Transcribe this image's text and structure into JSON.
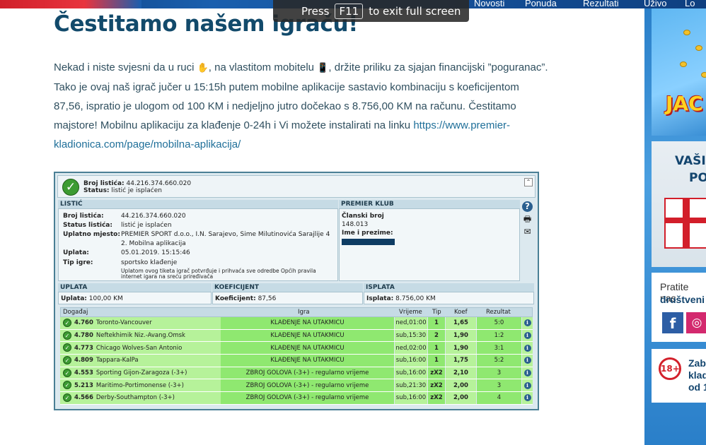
{
  "header": {
    "nav": [
      "Novosti",
      "Ponuda",
      "Rezultati",
      "Uživo",
      "Lo"
    ]
  },
  "fullscreen": {
    "press": "Press",
    "key": "F11",
    "suffix": "to exit full screen"
  },
  "article": {
    "title": "Čestitamo našem igraču!",
    "p1": "Nekad i niste svjesni da u ruci ",
    "icon_hand": "✋",
    "p2": ", na vlastitom mobitelu ",
    "icon_phone": "📱",
    "p3": ", držite priliku za sjajan financijski ”poguranac”. Tako je ovaj naš igrač jučer u 15:15h putem mobilne aplikacije sastavio kombinaciju s koeficijentom 87,56, ispratio je ulogom od 100 KM i nedjeljno jutro dočekao s 8.756,00 KM na računu. Čestitamo majstore! Mobilnu aplikaciju za klađenje 0-24h i Vi možete instalirati na linku ",
    "link": "https://www.premier-kladionica.com/page/mobilna-aplikacija/"
  },
  "ticket": {
    "head": {
      "l1_label": "Broj listića:",
      "l1_value": "44.216.374.660.020",
      "l2_label": "Status:",
      "l2_value": "listić je isplaćen"
    },
    "listic": {
      "title": "LISTIĆ",
      "rows": [
        {
          "label": "Broj listića:",
          "value": "44.216.374.660.020"
        },
        {
          "label": "Status listića:",
          "value": "listić je isplaćen"
        },
        {
          "label": "Uplatno mjesto:",
          "value": "PREMIER SPORT d.o.o., I.N. Sarajevo, Sime Milutinovića Sarajlije 4"
        },
        {
          "label": "",
          "value": "2. Mobilna aplikacija"
        },
        {
          "label": "Uplata:",
          "value": "05.01.2019. 15:15:46"
        },
        {
          "label": "Tip igre:",
          "value": "sportsko klađenje"
        }
      ],
      "note": "Uplatom ovog tiketa igrač potvrđuje i prihvaća sve odredbe Općih pravila internet igara na sreću priređivača"
    },
    "club": {
      "title": "PREMIER KLUB",
      "member_label": "Članski broj",
      "member_value": "148.013",
      "name_label": "Ime i prezime:"
    },
    "uplata": {
      "title": "UPLATA",
      "label": "Uplata:",
      "value": "100,00 KM"
    },
    "koef": {
      "title": "KOEFICIJENT",
      "label": "Koeficijent:",
      "value": "87,56"
    },
    "isplata": {
      "title": "ISPLATA",
      "label": "Isplata:",
      "value": "8.756,00 KM"
    },
    "columns": {
      "event": "Događaj",
      "game": "Igra",
      "time": "Vrijeme",
      "tip": "Tip",
      "odd": "Koef",
      "result": "Rezultat"
    },
    "rows": [
      {
        "code": "4.760",
        "event": "Toronto-Vancouver",
        "game": "KLAĐENJE NA UTAKMICU",
        "time": "ned,01:00",
        "tip": "1",
        "odd": "1,65",
        "result": "5:0"
      },
      {
        "code": "4.780",
        "event": "Neftekhimik Niz.-Avang.Omsk",
        "game": "KLAĐENJE NA UTAKMICU",
        "time": "sub,15:30",
        "tip": "2",
        "odd": "1,90",
        "result": "1:2"
      },
      {
        "code": "4.773",
        "event": "Chicago Wolves-San Antonio",
        "game": "KLAĐENJE NA UTAKMICU",
        "time": "ned,02:00",
        "tip": "1",
        "odd": "1,90",
        "result": "3:1"
      },
      {
        "code": "4.809",
        "event": "Tappara-KalPa",
        "game": "KLAĐENJE NA UTAKMICU",
        "time": "sub,16:00",
        "tip": "1",
        "odd": "1,75",
        "result": "5:2"
      },
      {
        "code": "4.553",
        "event": "Sporting Gijon-Zaragoza (-3+)",
        "game": "ZBROJ GOLOVA (-3+) - regularno vrijeme",
        "time": "sub,16:00",
        "tip": "zX2",
        "odd": "2,10",
        "result": "3"
      },
      {
        "code": "5.213",
        "event": "Maritimo-Portimonense (-3+)",
        "game": "ZBROJ GOLOVA (-3+) - regularno vrijeme",
        "time": "sub,21:30",
        "tip": "zX2",
        "odd": "2,00",
        "result": "3"
      },
      {
        "code": "4.566",
        "event": "Derby-Southampton (-3+)",
        "game": "ZBROJ GOLOVA (-3+) - regularno vrijeme",
        "time": "sub,16:00",
        "tip": "zX2",
        "odd": "2,00",
        "result": "4"
      }
    ]
  },
  "sidebar": {
    "ad1_text": "JAC",
    "ad2_line1": "VAŠI",
    "ad2_line2": "PO",
    "social_line1": "Pratite nas",
    "social_line2": "društveni",
    "fb": "f",
    "ig": "◎",
    "age_badge": "18+",
    "age_text": "Zab klad od 1"
  }
}
